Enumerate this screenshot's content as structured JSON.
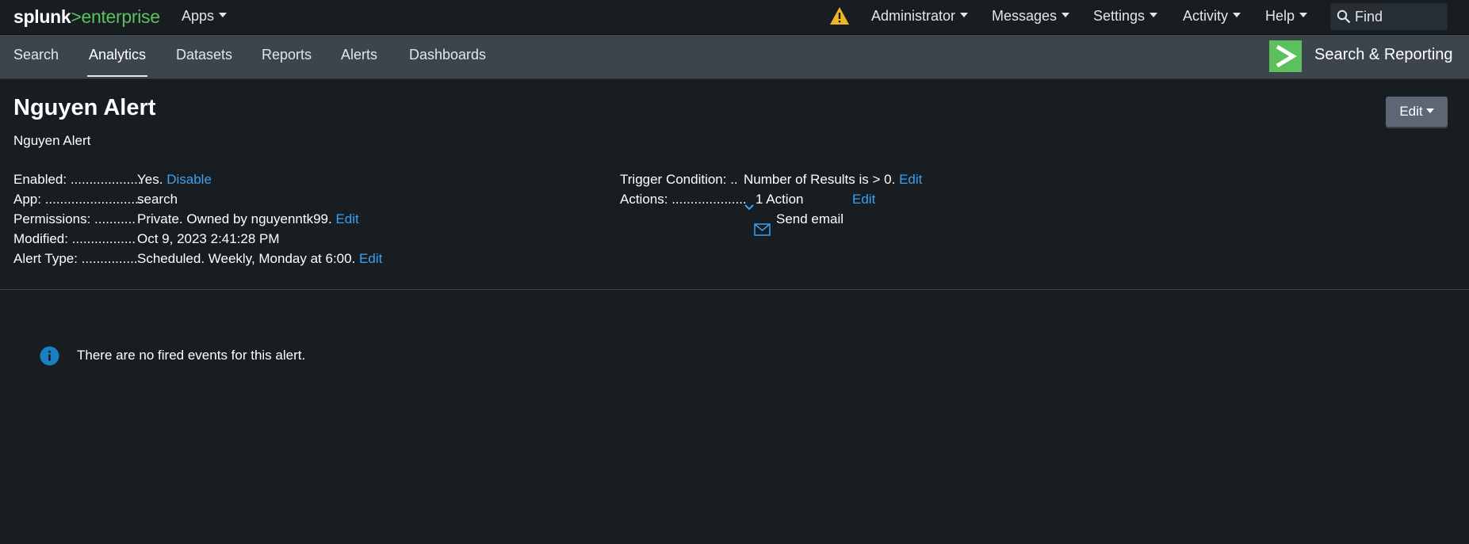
{
  "topbar": {
    "logo_splunk": "splunk",
    "logo_gt": ">",
    "logo_enterprise": "enterprise",
    "apps_label": "Apps",
    "menus": [
      "Administrator",
      "Messages",
      "Settings",
      "Activity",
      "Help"
    ],
    "find_placeholder": "Find",
    "warning_icon": "warning-triangle-icon",
    "warning_color": "#f0b429"
  },
  "appbar": {
    "tabs": [
      "Search",
      "Analytics",
      "Datasets",
      "Reports",
      "Alerts",
      "Dashboards"
    ],
    "active_tab": "Analytics",
    "app_title": "Search & Reporting",
    "app_icon_color": "#5cc05c"
  },
  "alert": {
    "title": "Nguyen Alert",
    "description": "Nguyen Alert",
    "edit_button": "Edit",
    "fields": [
      {
        "label": "Enabled: ...................",
        "value": "Yes.",
        "link": "Disable"
      },
      {
        "label": "App: ..........................",
        "value": "search",
        "link": ""
      },
      {
        "label": "Permissions: ...........",
        "value": "Private. Owned by nguyenntk99.",
        "link": "Edit"
      },
      {
        "label": "Modified: .................",
        "value": "Oct 9, 2023 2:41:28 PM",
        "link": ""
      },
      {
        "label": "Alert Type: ...............",
        "value": "Scheduled. Weekly, Monday at 6:00.",
        "link": "Edit"
      }
    ],
    "trigger": {
      "label": "Trigger Condition: ..",
      "value": "Number of Results is > 0.",
      "link": "Edit"
    },
    "actions": {
      "label": "Actions: ....................",
      "value": "1 Action",
      "link": "Edit",
      "item": "Send email"
    }
  },
  "events": {
    "message": "There are no fired events for this alert."
  },
  "colors": {
    "background": "#171d21",
    "appbar": "#3c444d",
    "link": "#3ca0f0",
    "info": "#1a7fc1"
  }
}
